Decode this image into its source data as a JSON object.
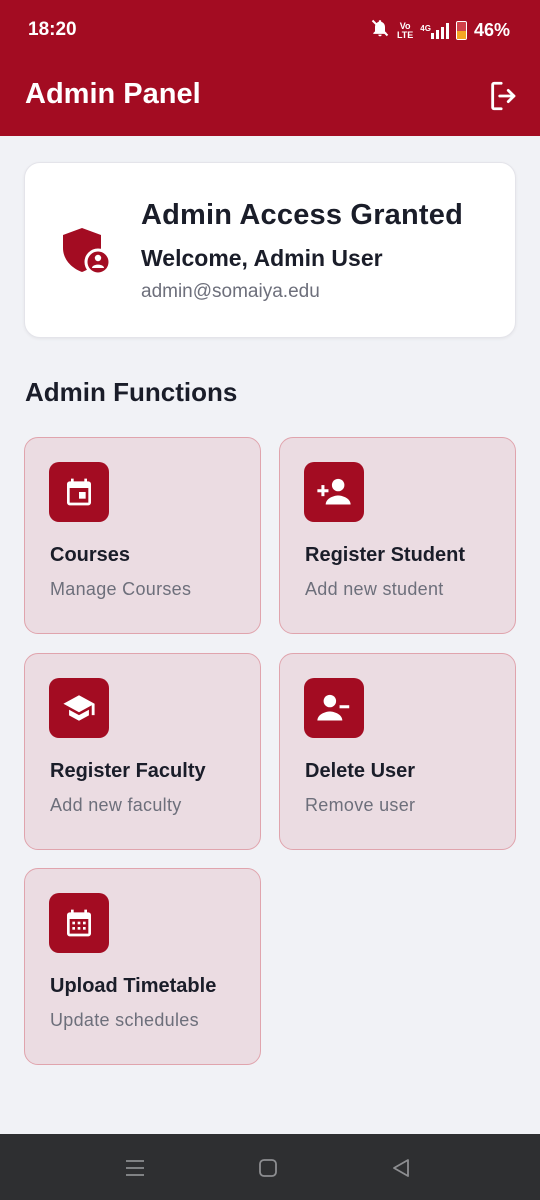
{
  "status_bar": {
    "time": "18:20",
    "volte_top": "Vo",
    "volte_bottom": "LTE",
    "network": "4G",
    "battery": "46%",
    "icons": [
      "mute-icon",
      "volte-icon",
      "signal-icon",
      "battery-icon"
    ]
  },
  "app_bar": {
    "title": "Admin Panel",
    "logout_icon": "logout-icon"
  },
  "profile": {
    "title": "Admin Access Granted",
    "welcome": "Welcome, Admin User",
    "email": "admin@somaiya.edu",
    "icon": "admin-shield-icon"
  },
  "section_title": "Admin Functions",
  "functions": [
    {
      "title": "Courses",
      "subtitle": "Manage Courses",
      "icon": "calendar-icon"
    },
    {
      "title": "Register Student",
      "subtitle": "Add new student",
      "icon": "person-add-icon"
    },
    {
      "title": "Register Faculty",
      "subtitle": "Add new faculty",
      "icon": "graduation-cap-icon"
    },
    {
      "title": "Delete User",
      "subtitle": "Remove user",
      "icon": "person-remove-icon"
    },
    {
      "title": "Upload Timetable",
      "subtitle": "Update schedules",
      "icon": "calendar-grid-icon"
    }
  ],
  "colors": {
    "primary": "#a30c22",
    "tile_bg": "#ebdce2",
    "tile_border": "#e0a4ad",
    "page_bg": "#f1f2f6",
    "nav_bg": "#2e2f31"
  },
  "nav_bar": {
    "buttons": [
      "menu-icon",
      "home-icon",
      "back-icon"
    ]
  }
}
